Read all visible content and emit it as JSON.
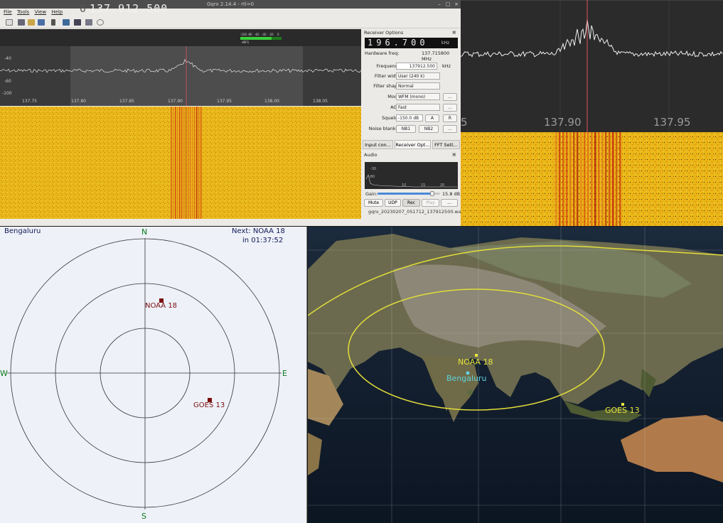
{
  "gqrx": {
    "title": "Gqrx 2.14.4 - rtl=0",
    "menu": [
      "File",
      "Tools",
      "View",
      "Help"
    ],
    "frequency_prefix": "0",
    "frequency": "137.912.500",
    "smeter_labels": [
      "-100",
      "-80",
      "-60",
      "-40",
      "-20",
      "0"
    ],
    "smeter_unit": "dBFS",
    "spectrum_ylabels": [
      "-40",
      "-60",
      "-100"
    ],
    "spectrum_xlabels": [
      "137.75",
      "137.80",
      "137.85",
      "137.90",
      "137.95",
      "138.00",
      "138.05"
    ]
  },
  "receiver": {
    "title": "Receiver Options",
    "lcd_value": "196.700",
    "lcd_unit": "kHz",
    "hw_freq_label": "Hardware freq:",
    "hw_freq_value": "137.715800 MHz",
    "frequency_label": "Frequency",
    "frequency_value": "137912.500",
    "frequency_unit": "kHz",
    "filter_width_label": "Filter width",
    "filter_width_value": "User (240 k)",
    "filter_shape_label": "Filter shape",
    "filter_shape_value": "Normal",
    "mode_label": "Mode",
    "mode_value": "WFM (mono)",
    "agc_label": "AGC",
    "agc_value": "Fast",
    "squelch_label": "Squelch",
    "squelch_value": "-150.0 dB",
    "squelch_btn_a": "A",
    "squelch_btn_r": "R",
    "noise_blanker_label": "Noise blanker",
    "nb1": "NB1",
    "nb2": "NB2",
    "more": "...",
    "tabs": [
      "Input con...",
      "Receiver Opt...",
      "FFT Sett..."
    ],
    "audio_title": "Audio",
    "audio_scope_labels": [
      "-30",
      "-80",
      "10",
      "15",
      "20"
    ],
    "gain_label": "Gain:",
    "gain_value": "15.8 dB",
    "gain_level": 0.88,
    "audio_buttons": [
      "Mute",
      "UDP",
      "Rec",
      "Play",
      "..."
    ],
    "rec_filename": "gqrx_20230207_051712_137912500.wav"
  },
  "zoom": {
    "xlabels": [
      "5",
      "137.90",
      "137.95"
    ]
  },
  "polar": {
    "location": "Bengaluru",
    "next_line1": "Next: NOAA 18",
    "next_line2": "in 01:37:52",
    "compass": {
      "n": "N",
      "s": "S",
      "e": "E",
      "w": "W"
    },
    "satellites": [
      {
        "name": "NOAA 18"
      },
      {
        "name": "GOES 13"
      }
    ]
  },
  "map": {
    "labels": {
      "noaa": "NOAA 18",
      "city": "Bengaluru",
      "goes": "GOES 13"
    },
    "colors": {
      "footprint": "#e2dd3a",
      "city": "#5fd3df",
      "sat": "#e6e43c"
    }
  }
}
